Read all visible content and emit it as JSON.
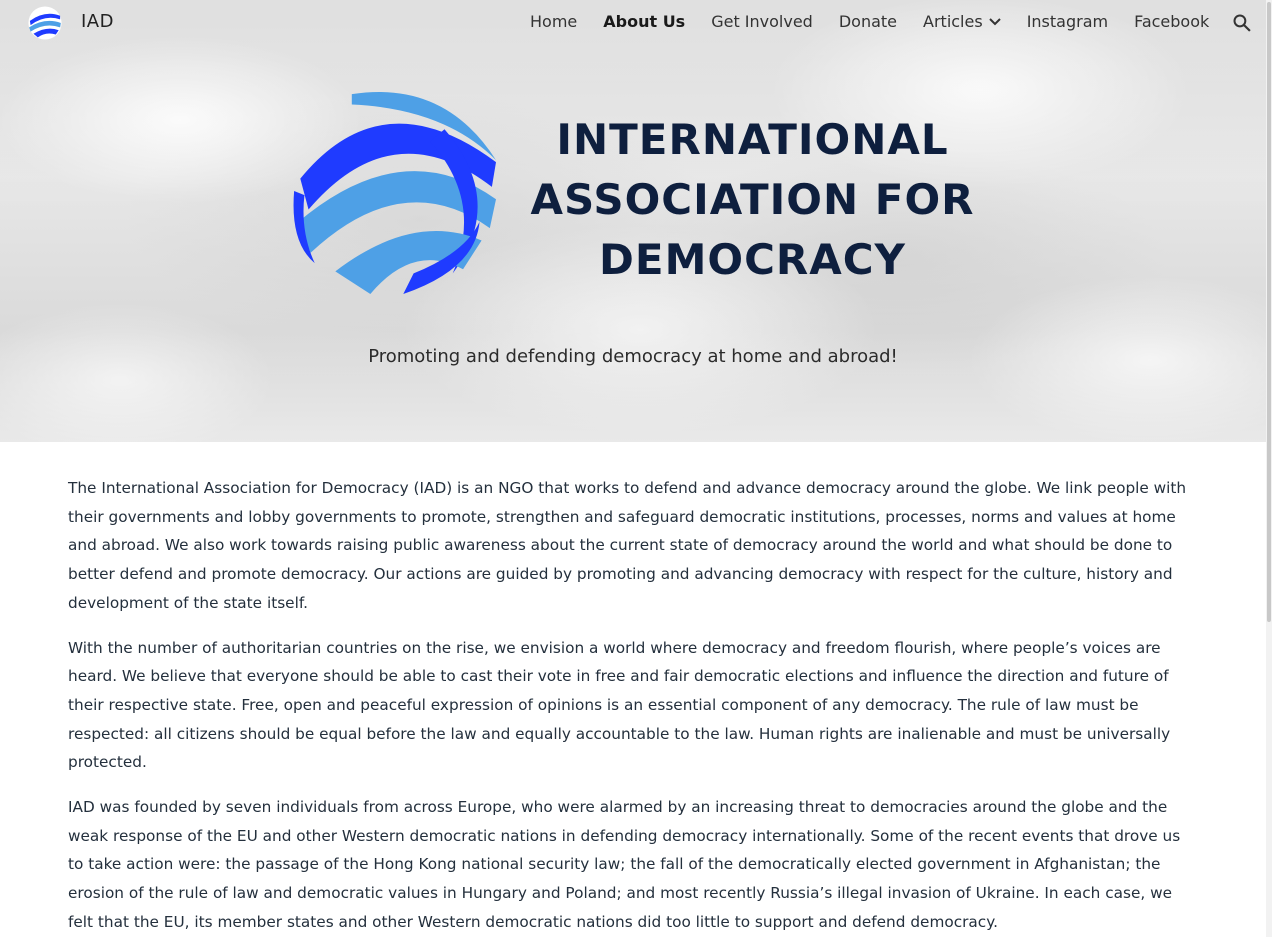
{
  "site": {
    "name": "IAD"
  },
  "nav": {
    "items": [
      {
        "label": "Home",
        "active": false
      },
      {
        "label": "About Us",
        "active": true
      },
      {
        "label": "Get Involved",
        "active": false
      },
      {
        "label": "Donate",
        "active": false
      },
      {
        "label": "Articles",
        "active": false,
        "has_dropdown": true
      },
      {
        "label": "Instagram",
        "active": false
      },
      {
        "label": "Facebook",
        "active": false
      }
    ],
    "search_icon": "search-icon"
  },
  "hero": {
    "title_lines": [
      "INTERNATIONAL",
      "ASSOCIATION FOR",
      "DEMOCRACY"
    ],
    "tagline": "Promoting and defending democracy at home and abroad!",
    "logo_colors": {
      "dark": "#1f3bff",
      "light": "#4ea0e6"
    }
  },
  "content": {
    "paragraphs": [
      "The International Association for Democracy (IAD) is an NGO that works to defend and advance democracy around the globe. We link people with their governments and lobby governments to promote, strengthen and safeguard democratic institutions, processes, norms and values at home and abroad. We also work towards raising public awareness about the current state of democracy around the world and what should be done to better defend and promote democracy. Our actions are guided by promoting and advancing democracy with respect for the culture, history and development of the state itself.",
      "With the number of authoritarian countries on the rise, we envision a world where democracy and freedom flourish, where people’s voices are heard. We believe that everyone should be able to cast their vote in free and fair democratic elections and influence the direction and future of their respective state. Free, open and peaceful expression of opinions is an essential component of any democracy. The rule of law must be respected: all citizens should be equal before the law and equally accountable to the law. Human rights are inalienable and must be universally protected.",
      "IAD was founded by seven individuals from across Europe, who were alarmed by an increasing threat to democracies around the globe and the weak response of the EU and other Western democratic nations in defending democracy internationally. Some of the recent events that drove us to take action were: the passage of the Hong Kong national security law; the fall of the democratically elected government in Afghanistan; the erosion of the rule of law and democratic values in Hungary and Poland; and most recently Russia’s illegal invasion of Ukraine. In each case, we felt that the EU, its member states and other Western democratic nations did too little to support and defend democracy."
    ]
  }
}
